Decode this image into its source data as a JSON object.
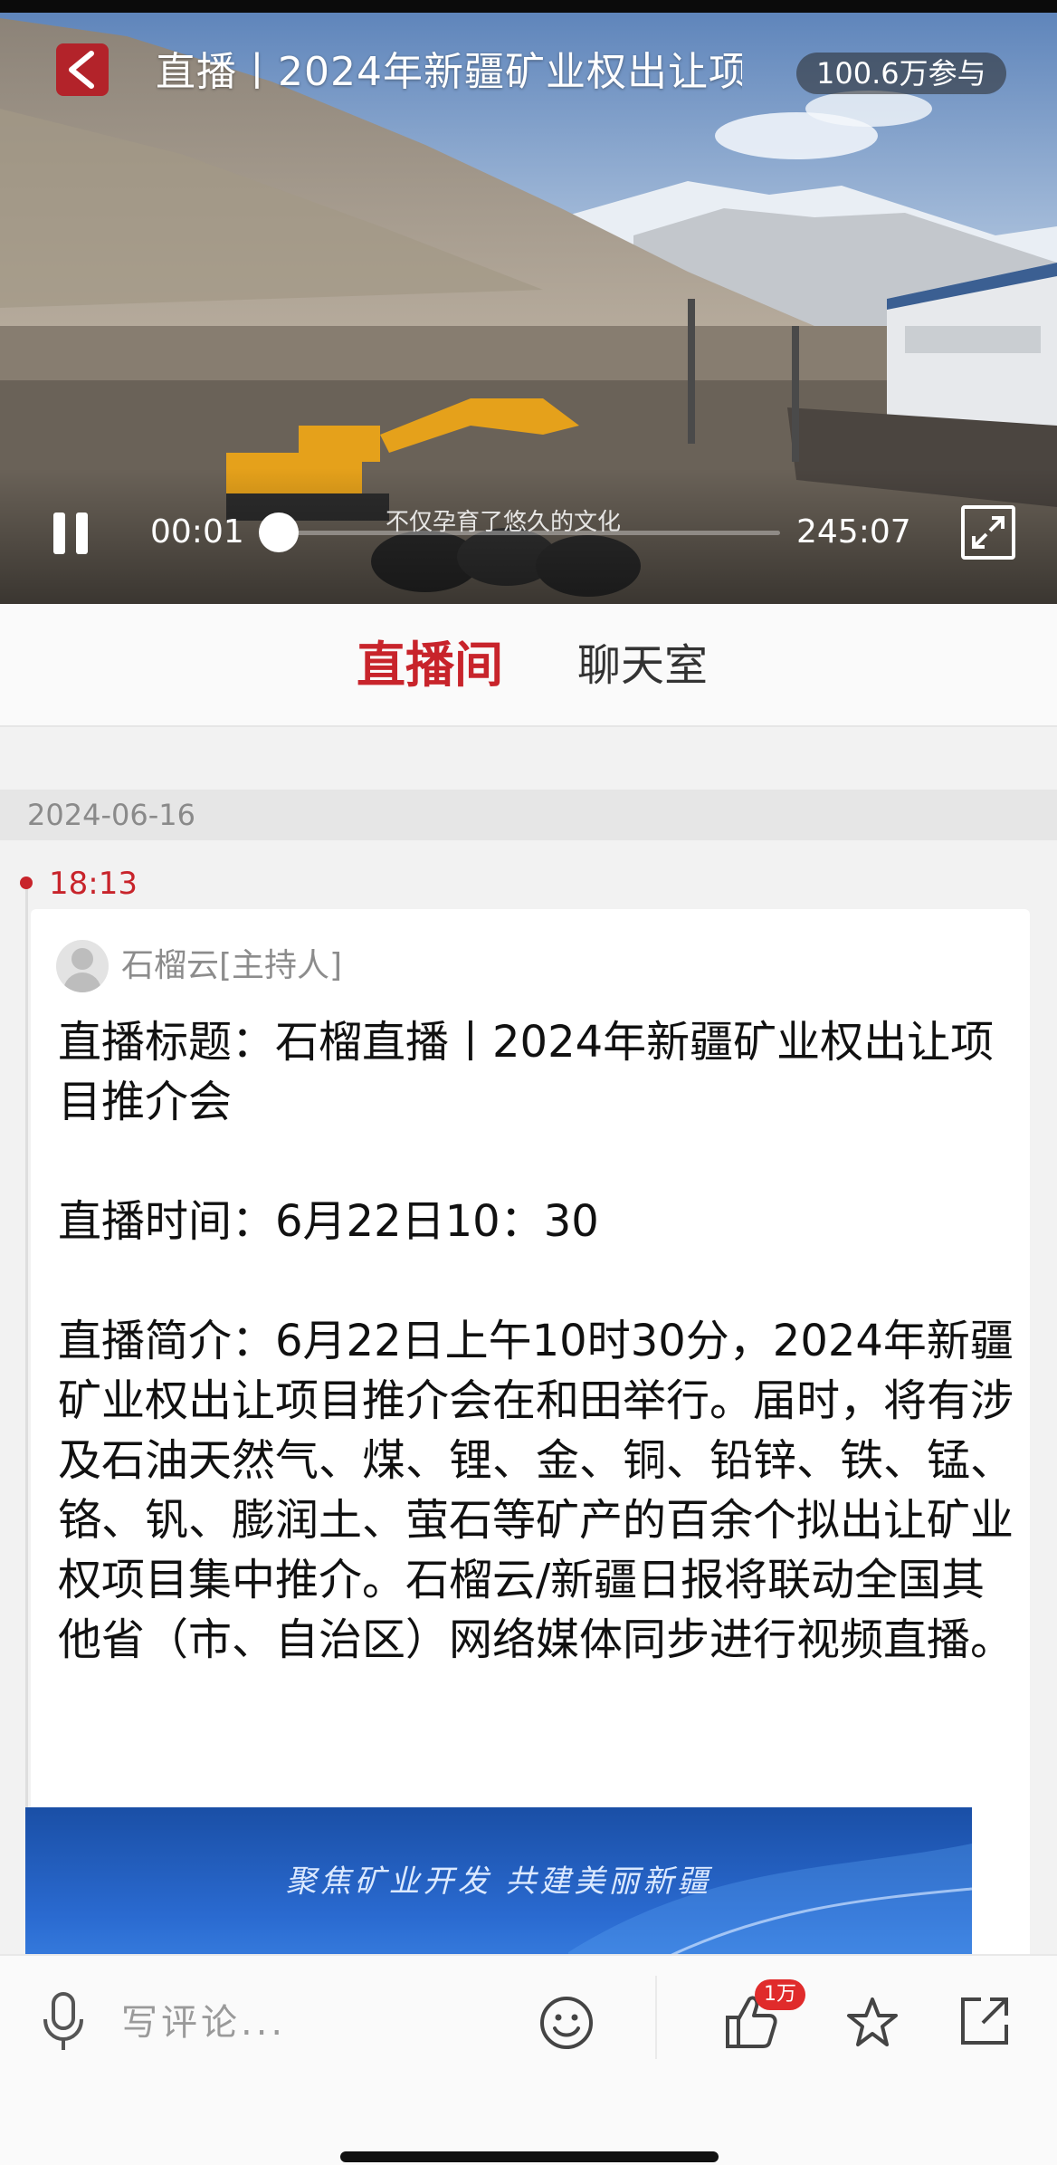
{
  "video": {
    "title": "直播丨2024年新疆矿业权出让项",
    "participants": "100.6万参与",
    "current_time": "00:01",
    "total_time": "245:07",
    "progress": 0.0,
    "subtitle": "不仅孕育了悠久的文化"
  },
  "tabs": [
    {
      "label": "直播间",
      "active": true
    },
    {
      "label": "聊天室",
      "active": false
    }
  ],
  "timeline": {
    "date": "2024-06-16",
    "time": "18:13"
  },
  "post": {
    "host": "石榴云[主持人]",
    "paragraphs": [
      "直播标题：石榴直播丨2024年新疆矿业权出让项目推介会",
      "直播时间：6月22日10：30",
      "直播简介：6月22日上午10时30分，2024年新疆矿业权出让项目推介会在和田举行。届时，将有涉及石油天然气、煤、锂、金、铜、铅锌、铁、锰、铬、钒、膨润土、萤石等矿产的百余个拟出让矿业权项目集中推介。石榴云/新疆日报将联动全国其他省（市、自治区）网络媒体同步进行视频直播。"
    ],
    "banner_slogan": "聚焦矿业开发  共建美丽新疆"
  },
  "bottom_bar": {
    "comment_placeholder": "写评论...",
    "like_count": "1万"
  },
  "colors": {
    "accent": "#c8242b",
    "badge": "#e02b2b"
  }
}
